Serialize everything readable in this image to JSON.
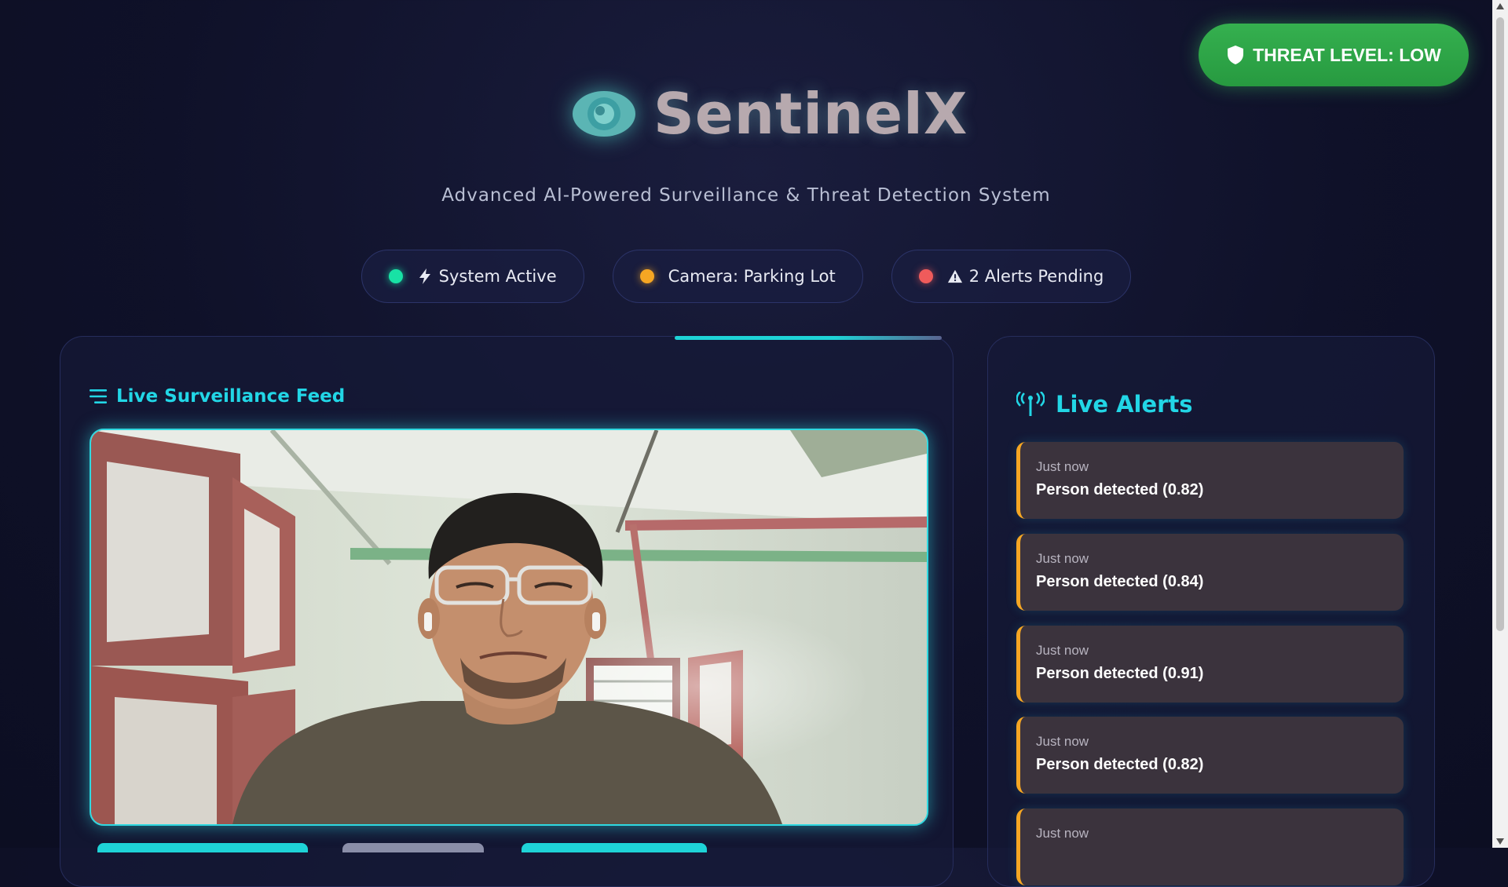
{
  "threat_badge": {
    "label": "THREAT LEVEL: LOW",
    "icon": "shield-icon",
    "color": "#2faa49"
  },
  "header": {
    "brand": "SentinelX",
    "brand_icon": "eye-icon",
    "subtitle": "Advanced AI-Powered Surveillance & Threat Detection System"
  },
  "status": {
    "system": {
      "label": "System Active",
      "icon": "lightning-icon",
      "dot_color": "#18e2a5"
    },
    "camera": {
      "label": "Camera: Parking Lot",
      "dot_color": "#f5a623"
    },
    "alerts": {
      "label": "2 Alerts Pending",
      "icon": "warning-icon",
      "dot_color": "#ef5b5b"
    }
  },
  "feed": {
    "title": "Live Surveillance Feed",
    "icon": "menu-lines-icon"
  },
  "alerts_panel": {
    "title": "Live Alerts",
    "icon": "broadcast-tower-icon",
    "items": [
      {
        "time": "Just now",
        "message": "Person detected (0.82)"
      },
      {
        "time": "Just now",
        "message": "Person detected (0.84)"
      },
      {
        "time": "Just now",
        "message": "Person detected (0.91)"
      },
      {
        "time": "Just now",
        "message": "Person detected (0.82)"
      },
      {
        "time": "Just now",
        "message": ""
      }
    ]
  },
  "colors": {
    "accent": "#22d6e6",
    "alert_border": "#f5a623",
    "background": "#0f1129"
  }
}
